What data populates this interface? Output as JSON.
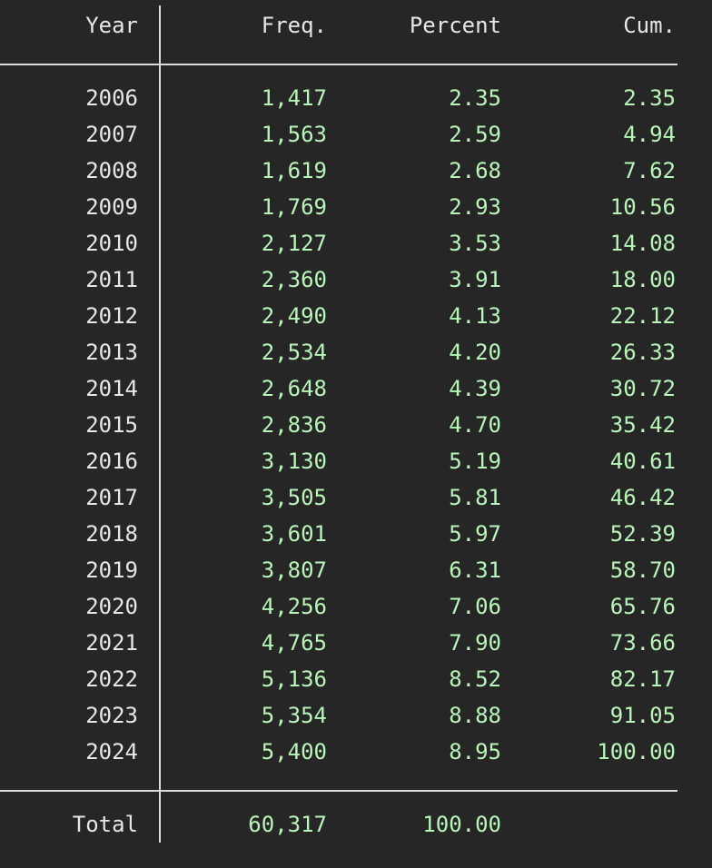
{
  "table": {
    "headers": {
      "year": "Year",
      "freq": "Freq.",
      "percent": "Percent",
      "cum": "Cum."
    },
    "rows": [
      {
        "year": "2006",
        "freq": "1,417",
        "percent": "2.35",
        "cum": "2.35"
      },
      {
        "year": "2007",
        "freq": "1,563",
        "percent": "2.59",
        "cum": "4.94"
      },
      {
        "year": "2008",
        "freq": "1,619",
        "percent": "2.68",
        "cum": "7.62"
      },
      {
        "year": "2009",
        "freq": "1,769",
        "percent": "2.93",
        "cum": "10.56"
      },
      {
        "year": "2010",
        "freq": "2,127",
        "percent": "3.53",
        "cum": "14.08"
      },
      {
        "year": "2011",
        "freq": "2,360",
        "percent": "3.91",
        "cum": "18.00"
      },
      {
        "year": "2012",
        "freq": "2,490",
        "percent": "4.13",
        "cum": "22.12"
      },
      {
        "year": "2013",
        "freq": "2,534",
        "percent": "4.20",
        "cum": "26.33"
      },
      {
        "year": "2014",
        "freq": "2,648",
        "percent": "4.39",
        "cum": "30.72"
      },
      {
        "year": "2015",
        "freq": "2,836",
        "percent": "4.70",
        "cum": "35.42"
      },
      {
        "year": "2016",
        "freq": "3,130",
        "percent": "5.19",
        "cum": "40.61"
      },
      {
        "year": "2017",
        "freq": "3,505",
        "percent": "5.81",
        "cum": "46.42"
      },
      {
        "year": "2018",
        "freq": "3,601",
        "percent": "5.97",
        "cum": "52.39"
      },
      {
        "year": "2019",
        "freq": "3,807",
        "percent": "6.31",
        "cum": "58.70"
      },
      {
        "year": "2020",
        "freq": "4,256",
        "percent": "7.06",
        "cum": "65.76"
      },
      {
        "year": "2021",
        "freq": "4,765",
        "percent": "7.90",
        "cum": "73.66"
      },
      {
        "year": "2022",
        "freq": "5,136",
        "percent": "8.52",
        "cum": "82.17"
      },
      {
        "year": "2023",
        "freq": "5,354",
        "percent": "8.88",
        "cum": "91.05"
      },
      {
        "year": "2024",
        "freq": "5,400",
        "percent": "8.95",
        "cum": "100.00"
      }
    ],
    "total": {
      "label": "Total",
      "freq": "60,317",
      "percent": "100.00"
    }
  },
  "colors": {
    "background": "#262626",
    "label_text": "#e6e6e6",
    "value_text": "#b8f5b8",
    "rule": "#dcdcdc"
  }
}
